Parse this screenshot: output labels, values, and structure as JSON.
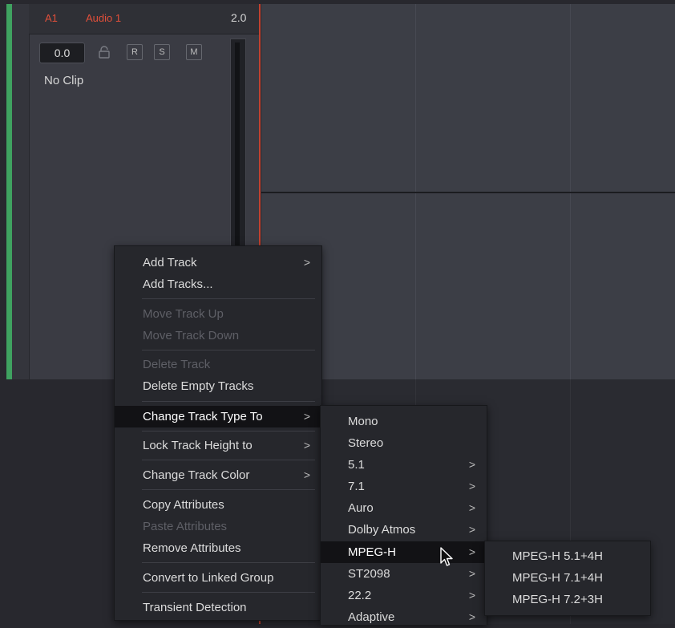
{
  "track": {
    "id": "A1",
    "name": "Audio 1",
    "format": "2.0",
    "volume": "0.0",
    "buttons": [
      "R",
      "S",
      "M"
    ],
    "clip_status": "No Clip"
  },
  "context_menu": {
    "items": [
      {
        "label": "Add Track",
        "submenu": true,
        "enabled": true
      },
      {
        "label": "Add Tracks...",
        "submenu": false,
        "enabled": true
      },
      {
        "label": "Move Track Up",
        "submenu": false,
        "enabled": false
      },
      {
        "label": "Move Track Down",
        "submenu": false,
        "enabled": false
      },
      {
        "label": "Delete Track",
        "submenu": false,
        "enabled": false
      },
      {
        "label": "Delete Empty Tracks",
        "submenu": false,
        "enabled": true
      },
      {
        "label": "Change Track Type To",
        "submenu": true,
        "enabled": true,
        "highlighted": true
      },
      {
        "label": "Lock Track Height to",
        "submenu": true,
        "enabled": true
      },
      {
        "label": "Change Track Color",
        "submenu": true,
        "enabled": true
      },
      {
        "label": "Copy Attributes",
        "submenu": false,
        "enabled": true
      },
      {
        "label": "Paste Attributes",
        "submenu": false,
        "enabled": false
      },
      {
        "label": "Remove Attributes",
        "submenu": false,
        "enabled": true
      },
      {
        "label": "Convert to Linked Group",
        "submenu": false,
        "enabled": true
      },
      {
        "label": "Transient Detection",
        "submenu": false,
        "enabled": true
      }
    ],
    "arrow_glyph": ">"
  },
  "track_type_menu": {
    "items": [
      {
        "label": "Mono",
        "submenu": false
      },
      {
        "label": "Stereo",
        "submenu": false
      },
      {
        "label": "5.1",
        "submenu": true
      },
      {
        "label": "7.1",
        "submenu": true
      },
      {
        "label": "Auro",
        "submenu": true
      },
      {
        "label": "Dolby Atmos",
        "submenu": true
      },
      {
        "label": "MPEG-H",
        "submenu": true,
        "highlighted": true
      },
      {
        "label": "ST2098",
        "submenu": true
      },
      {
        "label": "22.2",
        "submenu": true
      },
      {
        "label": "Adaptive",
        "submenu": true
      }
    ]
  },
  "mpegh_menu": {
    "items": [
      {
        "label": "MPEG-H 5.1+4H"
      },
      {
        "label": "MPEG-H 7.1+4H"
      },
      {
        "label": "MPEG-H 7.2+3H"
      }
    ]
  },
  "colors": {
    "track_accent": "#e14f3a",
    "track_strip": "#3fa260",
    "playhead": "#c2412f",
    "menu_bg": "#26272c",
    "menu_highlight": "#121215"
  },
  "icons": {
    "lock": "lock-icon",
    "cursor": "mouse-pointer-icon"
  }
}
